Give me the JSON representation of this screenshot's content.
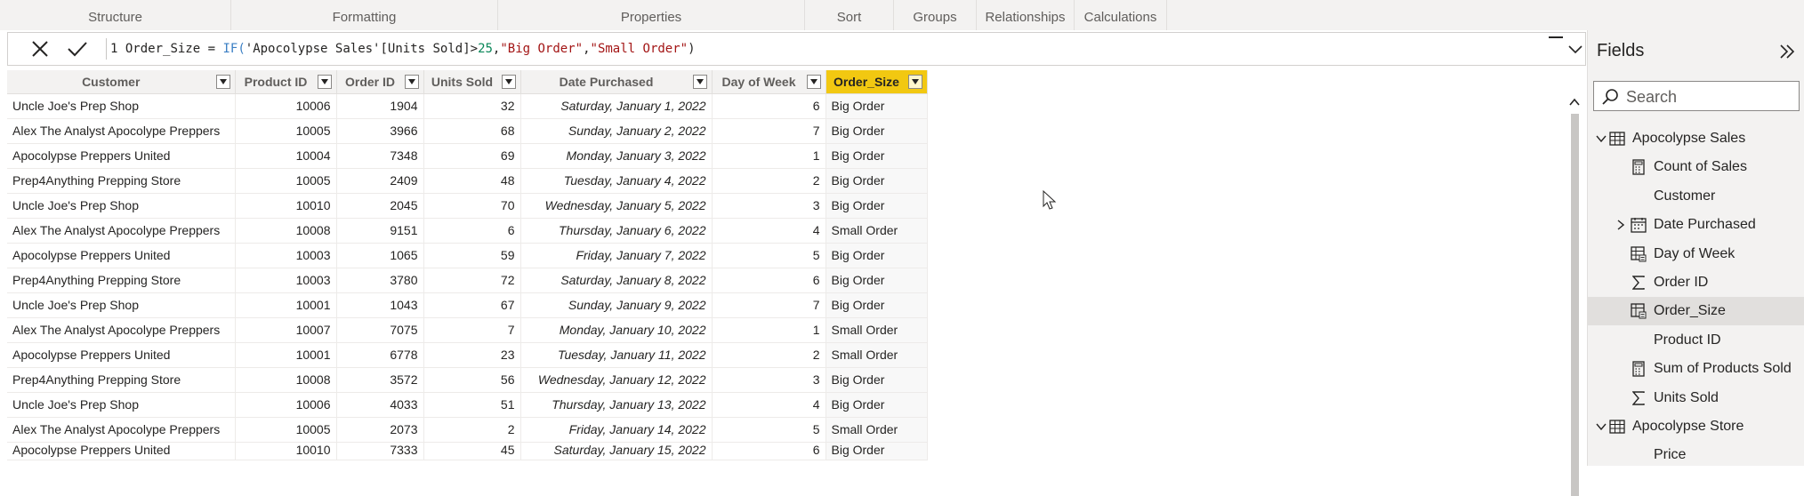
{
  "ribbon": {
    "groups": [
      "Structure",
      "Formatting",
      "Properties",
      "Sort",
      "Groups",
      "Relationships",
      "Calculations"
    ]
  },
  "formula_bar": {
    "line_number": "1",
    "measure_name": "Order_Size",
    "operator": " = ",
    "function": "IF(",
    "reference": "'Apocolypse Sales'[Units Sold]>",
    "number": "25",
    "comma1": ",",
    "string1": "\"Big Order\"",
    "comma2": ",",
    "string2": "\"Small Order\"",
    "close": ")",
    "cancel_icon": "x-icon",
    "commit_icon": "check-icon",
    "expand_icon": "chevron-down-icon"
  },
  "table": {
    "columns": [
      "Customer",
      "Product ID",
      "Order ID",
      "Units Sold",
      "Date Purchased",
      "Day of Week",
      "Order_Size"
    ],
    "selected_column": "Order_Size",
    "rows": [
      [
        "Uncle Joe's Prep Shop",
        "10006",
        "1904",
        "32",
        "Saturday, January 1, 2022",
        "6",
        "Big Order"
      ],
      [
        "Alex The Analyst Apocolype Preppers",
        "10005",
        "3966",
        "68",
        "Sunday, January 2, 2022",
        "7",
        "Big Order"
      ],
      [
        "Apocolypse Preppers United",
        "10004",
        "7348",
        "69",
        "Monday, January 3, 2022",
        "1",
        "Big Order"
      ],
      [
        "Prep4Anything Prepping Store",
        "10005",
        "2409",
        "48",
        "Tuesday, January 4, 2022",
        "2",
        "Big Order"
      ],
      [
        "Uncle Joe's Prep Shop",
        "10010",
        "2045",
        "70",
        "Wednesday, January 5, 2022",
        "3",
        "Big Order"
      ],
      [
        "Alex The Analyst Apocolype Preppers",
        "10008",
        "9151",
        "6",
        "Thursday, January 6, 2022",
        "4",
        "Small Order"
      ],
      [
        "Apocolypse Preppers United",
        "10003",
        "1065",
        "59",
        "Friday, January 7, 2022",
        "5",
        "Big Order"
      ],
      [
        "Prep4Anything Prepping Store",
        "10003",
        "3780",
        "72",
        "Saturday, January 8, 2022",
        "6",
        "Big Order"
      ],
      [
        "Uncle Joe's Prep Shop",
        "10001",
        "1043",
        "67",
        "Sunday, January 9, 2022",
        "7",
        "Big Order"
      ],
      [
        "Alex The Analyst Apocolype Preppers",
        "10007",
        "7075",
        "7",
        "Monday, January 10, 2022",
        "1",
        "Small Order"
      ],
      [
        "Apocolypse Preppers United",
        "10001",
        "6778",
        "23",
        "Tuesday, January 11, 2022",
        "2",
        "Small Order"
      ],
      [
        "Prep4Anything Prepping Store",
        "10008",
        "3572",
        "56",
        "Wednesday, January 12, 2022",
        "3",
        "Big Order"
      ],
      [
        "Uncle Joe's Prep Shop",
        "10006",
        "4033",
        "51",
        "Thursday, January 13, 2022",
        "4",
        "Big Order"
      ],
      [
        "Alex The Analyst Apocolype Preppers",
        "10005",
        "2073",
        "2",
        "Friday, January 14, 2022",
        "5",
        "Small Order"
      ],
      [
        "Apocolypse Preppers United",
        "10010",
        "7333",
        "45",
        "Saturday, January 15, 2022",
        "6",
        "Big Order"
      ]
    ]
  },
  "fields_pane": {
    "title": "Fields",
    "collapse_icon": "double-chevron-right-icon",
    "search_placeholder": "Search",
    "items": [
      {
        "label": "Apocolypse Sales",
        "icon": "table-icon",
        "level": 0,
        "expand": "chevron-down-icon"
      },
      {
        "label": "Count of Sales",
        "icon": "calculator-icon",
        "level": 1
      },
      {
        "label": "Customer",
        "icon": "",
        "level": 1
      },
      {
        "label": "Date Purchased",
        "icon": "calendar-icon",
        "level": 1,
        "expand": "chevron-right-icon"
      },
      {
        "label": "Day of Week",
        "icon": "calculated-table-icon",
        "level": 1
      },
      {
        "label": "Order ID",
        "icon": "sigma-icon",
        "level": 1
      },
      {
        "label": "Order_Size",
        "icon": "calculated-column-icon",
        "level": 1,
        "selected": true
      },
      {
        "label": "Product ID",
        "icon": "",
        "level": 1
      },
      {
        "label": "Sum of Products Sold",
        "icon": "calculator-icon",
        "level": 1
      },
      {
        "label": "Units Sold",
        "icon": "sigma-icon",
        "level": 1
      },
      {
        "label": "Apocolypse Store",
        "icon": "table-icon",
        "level": 0,
        "expand": "chevron-down-icon"
      },
      {
        "label": "Price",
        "icon": "",
        "level": 1
      }
    ]
  },
  "colors": {
    "accent_selected_column": "#f2c811",
    "formula_function": "#3b7fc4",
    "formula_number": "#098658",
    "formula_string": "#a31515"
  }
}
